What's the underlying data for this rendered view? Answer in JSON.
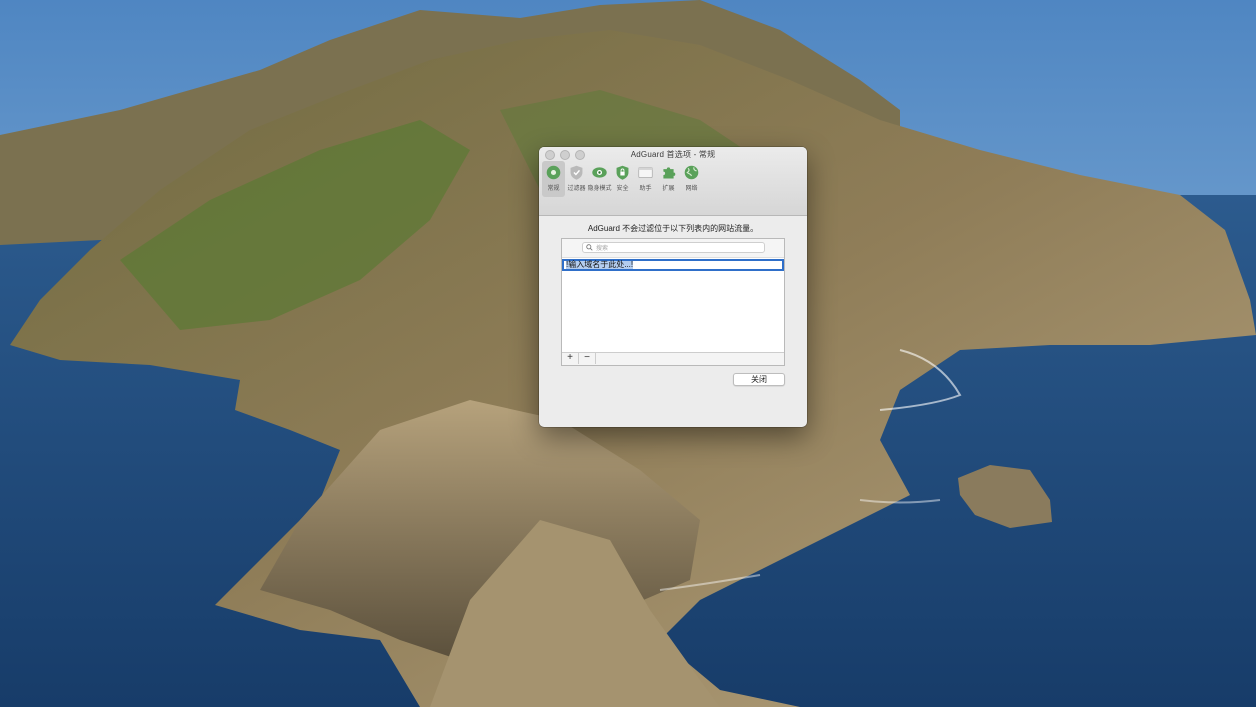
{
  "window": {
    "title": "AdGuard 首选项 - 常规"
  },
  "toolbar": {
    "items": [
      {
        "label": "常规",
        "icon": "general-icon",
        "selected": true
      },
      {
        "label": "过滤器",
        "icon": "shield-icon"
      },
      {
        "label": "隐身模式",
        "icon": "eye-icon"
      },
      {
        "label": "安全",
        "icon": "lock-shield-icon"
      },
      {
        "label": "助手",
        "icon": "browser-window-icon"
      },
      {
        "label": "扩展",
        "icon": "puzzle-icon"
      },
      {
        "label": "网络",
        "icon": "globe-icon"
      }
    ]
  },
  "main": {
    "description": "AdGuard 不会过滤位于以下列表内的网站流量。",
    "search": {
      "placeholder": "搜索"
    },
    "editing_row": {
      "value": "!输入域名于此处...!"
    },
    "add_label": "+",
    "remove_label": "−",
    "close_label": "关闭"
  },
  "colors": {
    "accent": "#2f6fc9",
    "selection": "#b4cdee",
    "toolbar_green": "#5aa15a"
  }
}
